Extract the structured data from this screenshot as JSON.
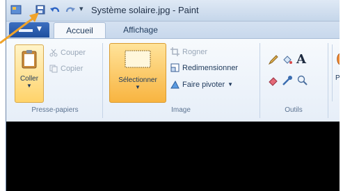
{
  "title": "Système solaire.jpg - Paint",
  "qat": {
    "menu_glyph": "▾"
  },
  "tabs": {
    "accueil": "Accueil",
    "affichage": "Affichage"
  },
  "clipboard": {
    "coller": "Coller",
    "couper": "Couper",
    "copier": "Copier",
    "label": "Presse-papiers"
  },
  "image": {
    "selectionner": "Sélectionner",
    "rogner": "Rogner",
    "redimensionner": "Redimensionner",
    "faire_pivoter": "Faire pivoter",
    "label": "Image"
  },
  "tools": {
    "text_glyph": "A",
    "label": "Outils"
  },
  "shapes_partial": "Pi",
  "colors": {
    "title_bg": "#dfe9f5",
    "file_tab": "#2a5fb0",
    "highlight": "#f8b440",
    "canvas": "#000000",
    "arrow": "#f0a32a"
  }
}
